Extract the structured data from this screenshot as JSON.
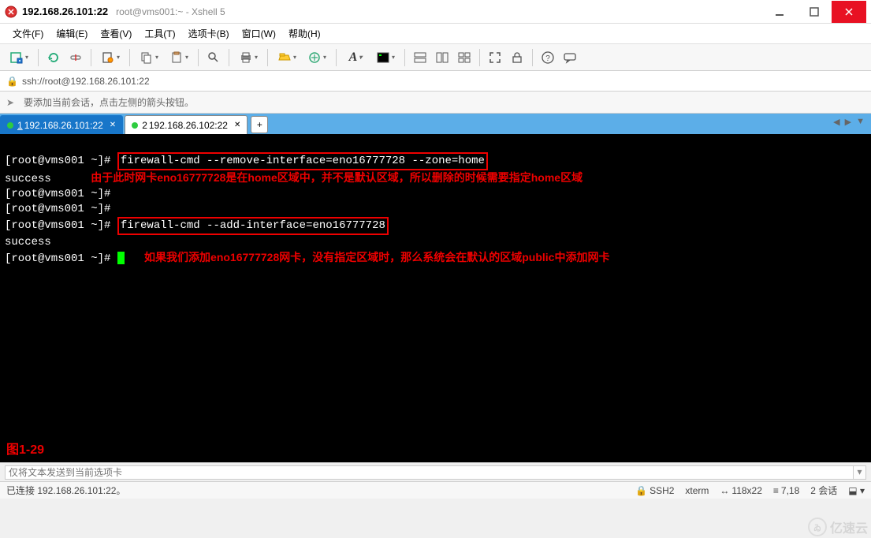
{
  "title": {
    "ip": "192.168.26.101:22",
    "app": "root@vms001:~ - Xshell 5"
  },
  "menu": {
    "file": "文件(F)",
    "edit": "编辑(E)",
    "view": "查看(V)",
    "tools": "工具(T)",
    "tab": "选项卡(B)",
    "window": "窗口(W)",
    "help": "帮助(H)"
  },
  "address": {
    "url": "ssh://root@192.168.26.101:22"
  },
  "infobar": {
    "text": "要添加当前会话，点击左侧的箭头按钮。"
  },
  "tabs": [
    {
      "num": "1",
      "label": "192.168.26.101:22",
      "active": true
    },
    {
      "num": "2",
      "label": "192.168.26.102:22",
      "active": false
    }
  ],
  "addtab_label": "+",
  "terminal": {
    "prompt": "[root@vms001 ~]#",
    "cmd1": "firewall-cmd --remove-interface=eno16777728 --zone=home",
    "out1": "success",
    "annot1": "由于此时网卡eno16777728是在home区域中，并不是默认区域，所以删除的时候需要指定home区域",
    "cmd2": "firewall-cmd --add-interface=eno16777728",
    "out2": "success",
    "annot2": "如果我们添加eno16777728网卡，没有指定区域时，那么系统会在默认的区域public中添加网卡",
    "figlabel": "图1-29"
  },
  "sendbar": {
    "placeholder": "仅将文本发送到当前选项卡"
  },
  "status": {
    "conn": "已连接 192.168.26.101:22。",
    "protocol": "SSH2",
    "term": "xterm",
    "size": "118x22",
    "pos": "7,18",
    "sessions": "2 会话"
  },
  "watermark": "亿速云"
}
